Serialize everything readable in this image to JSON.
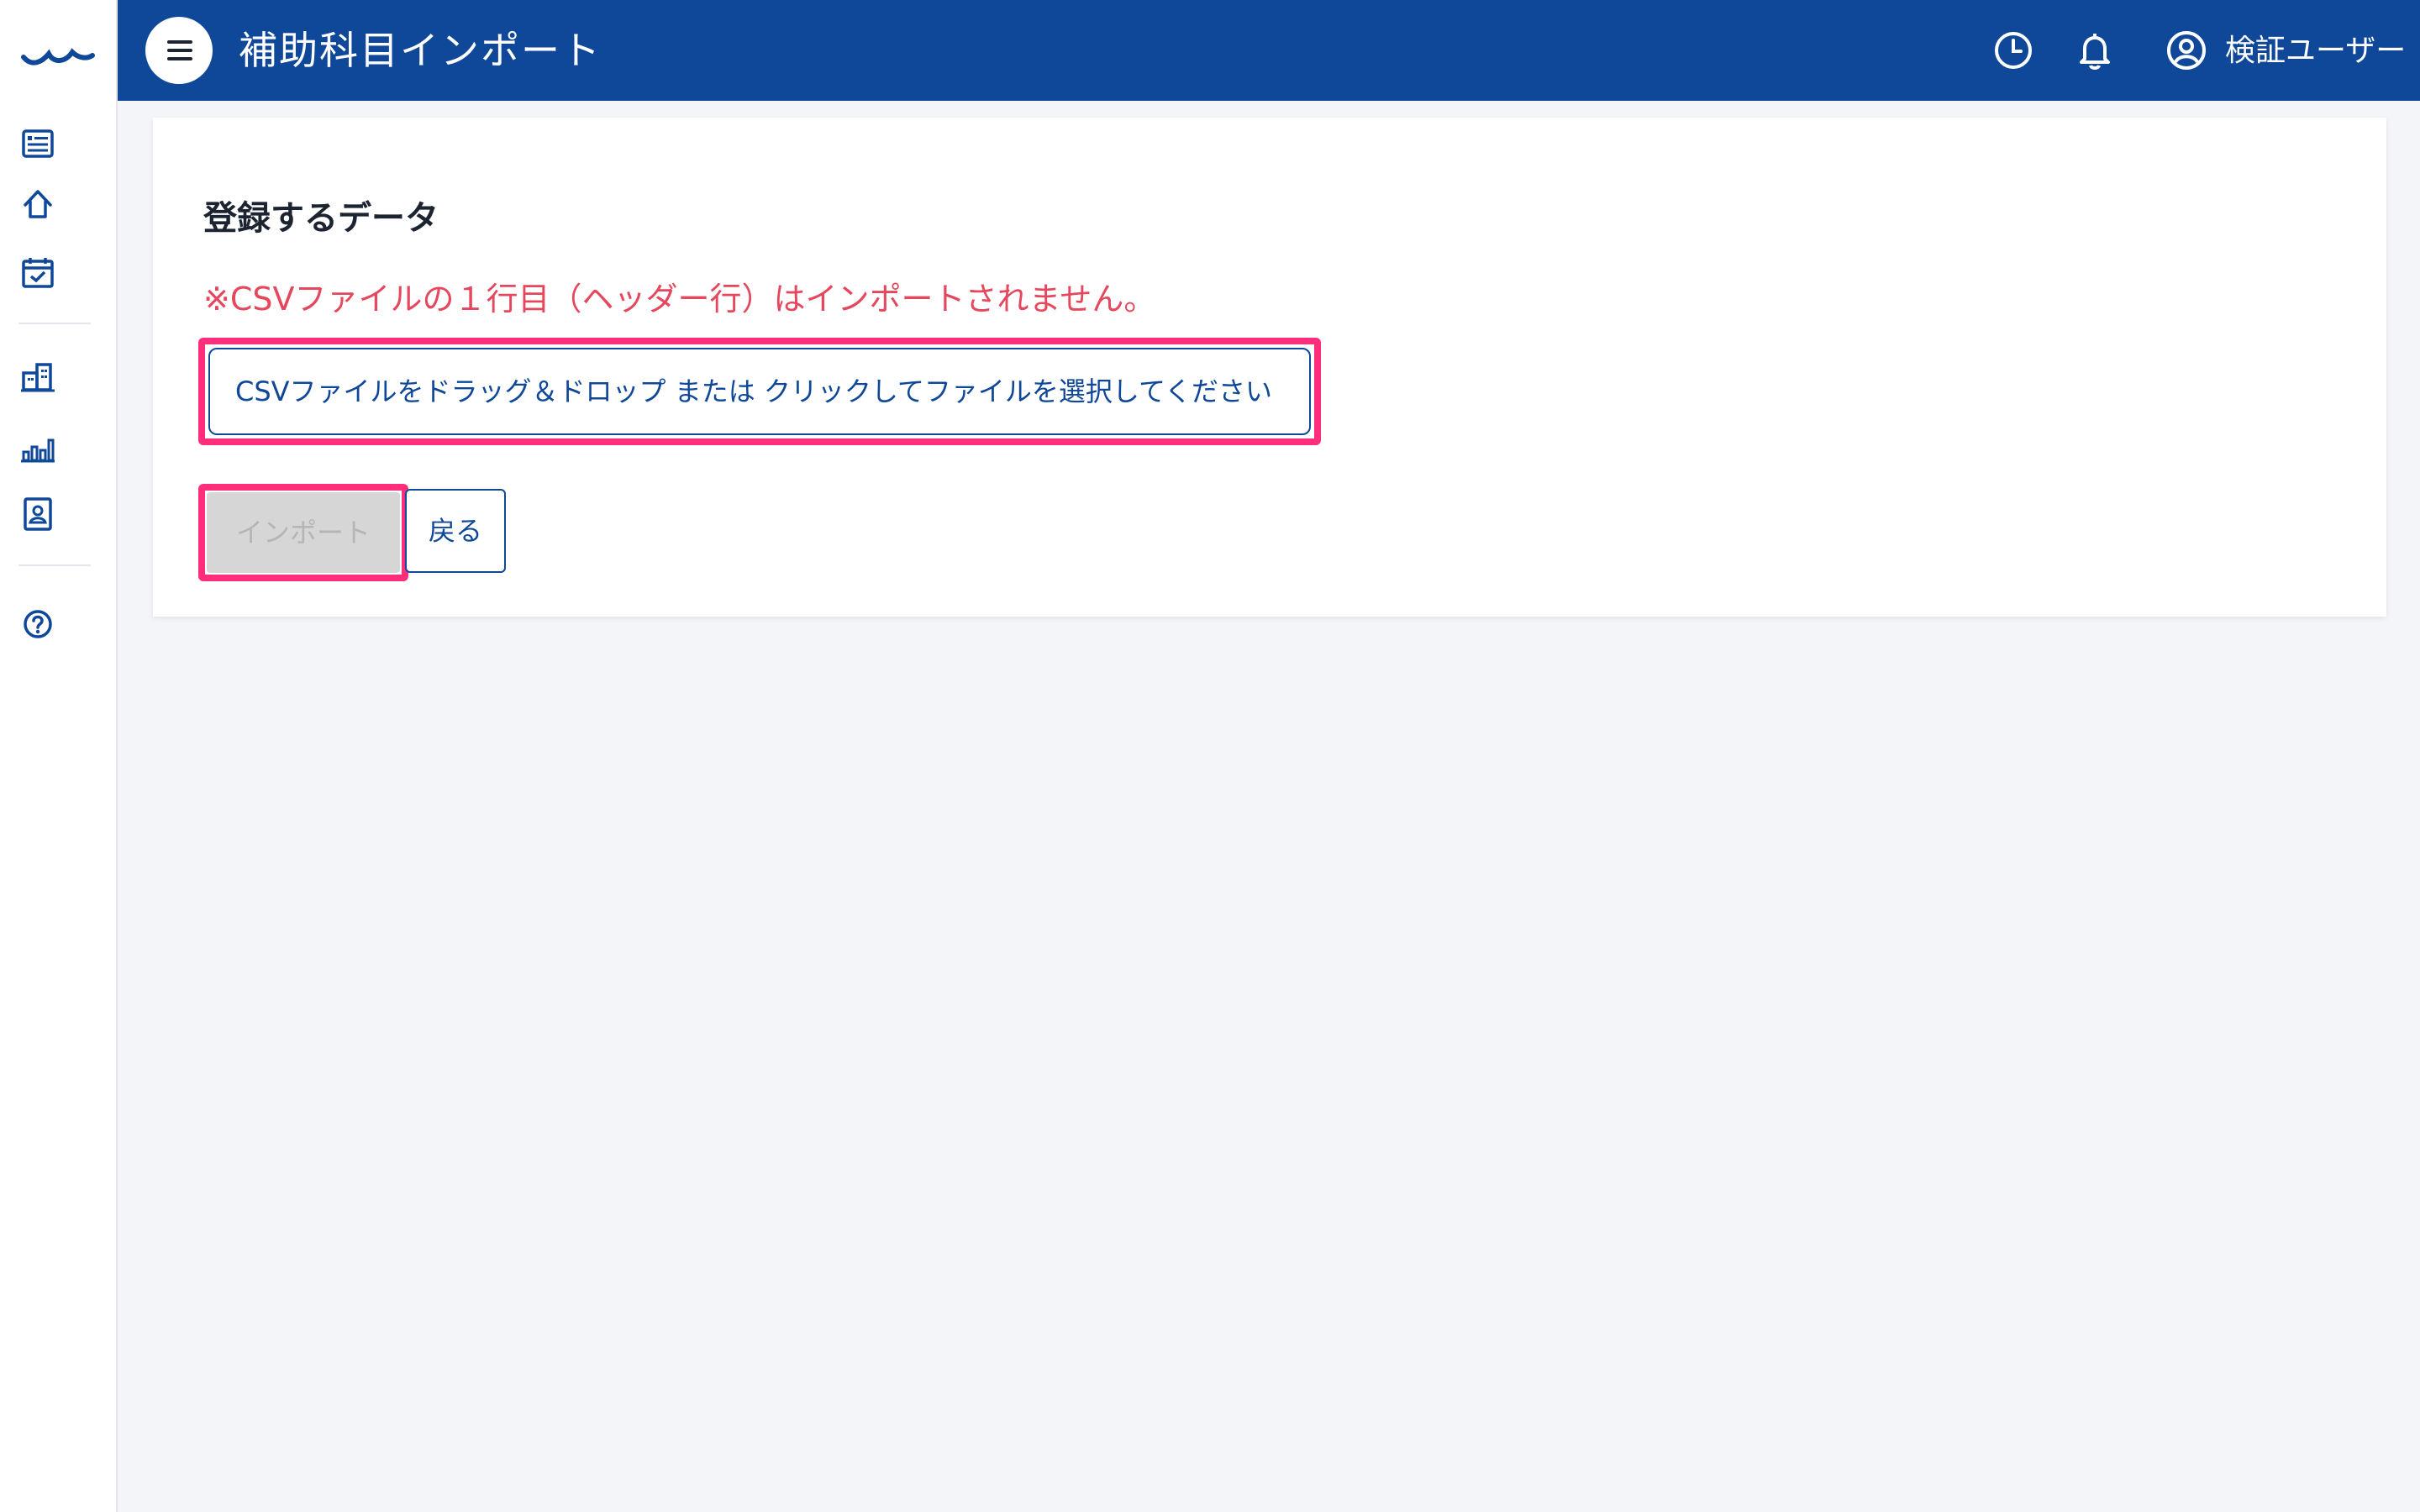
{
  "header": {
    "title": "補助科目インポート",
    "user_name": "検証ユーザー",
    "background_color": "#0f4799",
    "icons": [
      "hamburger-menu-icon",
      "history-clock-icon",
      "notification-bell-icon",
      "user-account-icon"
    ]
  },
  "sidebar": {
    "logo": "brand-logo",
    "items": [
      {
        "icon": "list-document-icon"
      },
      {
        "icon": "home-icon"
      },
      {
        "icon": "calendar-check-icon"
      },
      {
        "icon": "building-icon"
      },
      {
        "icon": "bar-chart-icon"
      },
      {
        "icon": "contact-card-icon"
      },
      {
        "icon": "help-icon"
      }
    ]
  },
  "main": {
    "section_title": "登録するデータ",
    "notice": "※CSVファイルの１行目（ヘッダー行）はインポートされません。",
    "notice_color": "#e5485d",
    "dropzone_text": "CSVファイルをドラッグ＆ドロップ または クリックしてファイルを選択してください",
    "import_button": "インポート",
    "import_button_state": "disabled",
    "back_button": "戻る",
    "highlight_color": "#ff2e7a"
  }
}
